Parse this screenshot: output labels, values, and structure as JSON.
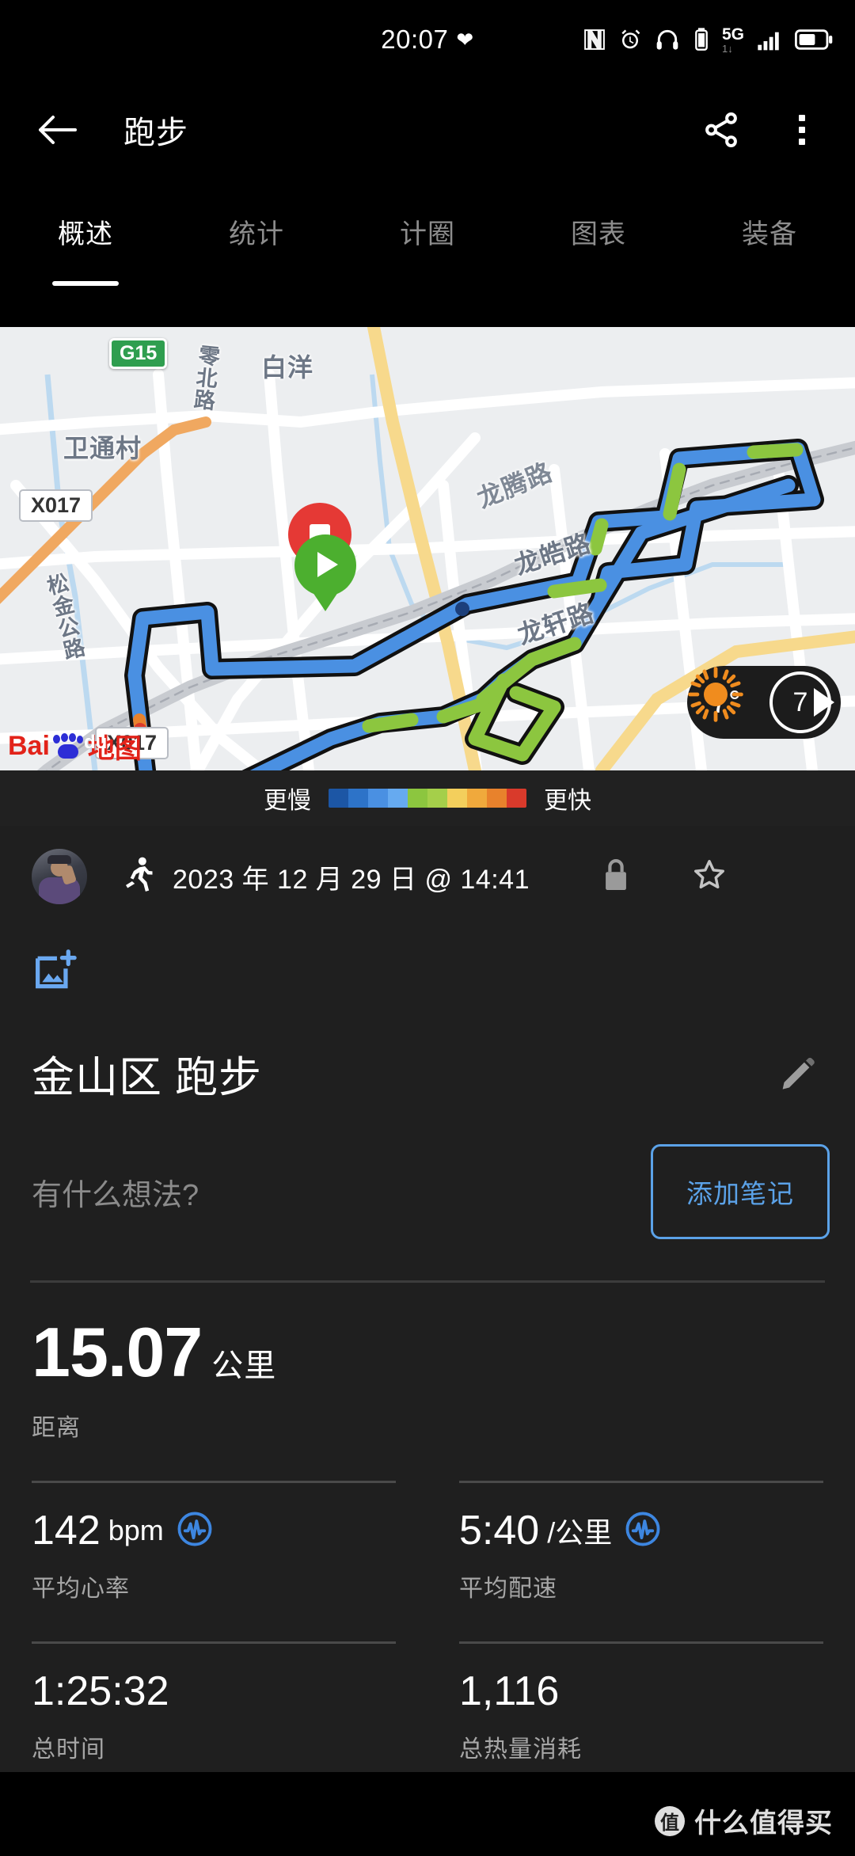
{
  "status_bar": {
    "time": "20:07",
    "heart_icon": "heart-icon",
    "icons": [
      "nfc-icon",
      "alarm-icon",
      "headphones-icon",
      "vibrate-icon",
      "network-5g-icon",
      "signal-bars-icon",
      "battery-icon"
    ],
    "network_label": "5G"
  },
  "app_bar": {
    "back_icon": "back-arrow-icon",
    "title": "跑步",
    "share_icon": "share-icon",
    "more_icon": "more-vertical-icon"
  },
  "tabs": [
    {
      "label": "概述",
      "active": true
    },
    {
      "label": "统计",
      "active": false
    },
    {
      "label": "计圈",
      "active": false
    },
    {
      "label": "图表",
      "active": false
    },
    {
      "label": "装备",
      "active": false
    }
  ],
  "map": {
    "provider": "Baidu",
    "provider_text_1": "Bai",
    "provider_text_2": "du",
    "provider_text_3": "地图",
    "labels": [
      {
        "text": "G15",
        "type": "highway-shield"
      },
      {
        "text": "零北路",
        "type": "street"
      },
      {
        "text": "白洋",
        "type": "place"
      },
      {
        "text": "卫通村",
        "type": "place"
      },
      {
        "text": "X017",
        "type": "road-box"
      },
      {
        "text": "松金公路",
        "type": "street"
      },
      {
        "text": "X017",
        "type": "road-box"
      },
      {
        "text": "龙皓路",
        "type": "street"
      },
      {
        "text": "龙轩路",
        "type": "street"
      },
      {
        "text": "龙腾路",
        "type": "street"
      }
    ],
    "start_marker": "play-marker-icon",
    "end_marker": "stop-marker-icon",
    "weather": {
      "temperature": "7°",
      "condition_icon": "sun-icon",
      "wind": "7"
    }
  },
  "legend": {
    "slower": "更慢",
    "faster": "更快",
    "colors": [
      "#1c56a5",
      "#2d73c8",
      "#4a90e2",
      "#66aaf0",
      "#8cc63f",
      "#a5cf4a",
      "#f3cf5c",
      "#f0a93c",
      "#e8822c",
      "#d93a2b"
    ]
  },
  "activity": {
    "avatar": "user-avatar",
    "sport_icon": "running-icon",
    "date": "2023 年 12 月 29 日 @ 14:41",
    "privacy_icon": "lock-icon",
    "favorite_icon": "star-outline-icon",
    "add_photo_icon": "add-photo-icon",
    "title": "金山区 跑步",
    "edit_icon": "pencil-icon",
    "notes_placeholder": "有什么想法?",
    "add_note_label": "添加笔记"
  },
  "stats": {
    "primary": {
      "value": "15.07",
      "unit": "公里",
      "label": "距离"
    },
    "cells": [
      {
        "value": "142",
        "unit": "bpm",
        "label": "平均心率",
        "icon": "heart-rate-icon"
      },
      {
        "value": "5:40",
        "unit": "/公里",
        "label": "平均配速",
        "icon": "heart-rate-icon"
      },
      {
        "value": "1:25:32",
        "unit": "",
        "label": "总时间",
        "icon": ""
      },
      {
        "value": "1,116",
        "unit": "",
        "label": "总热量消耗",
        "icon": ""
      }
    ]
  },
  "watermark": {
    "logo": "值",
    "text": "什么值得买"
  },
  "colors": {
    "accent_blue": "#5ba2e8",
    "background": "#1f1f1f",
    "app_bar": "#000000",
    "muted_text": "#a6a6a6",
    "route_blue": "#4a90e2",
    "route_green": "#8cc63f",
    "start_green": "#4caf2f",
    "end_red": "#e53935",
    "sun_orange": "#f08c1e"
  }
}
